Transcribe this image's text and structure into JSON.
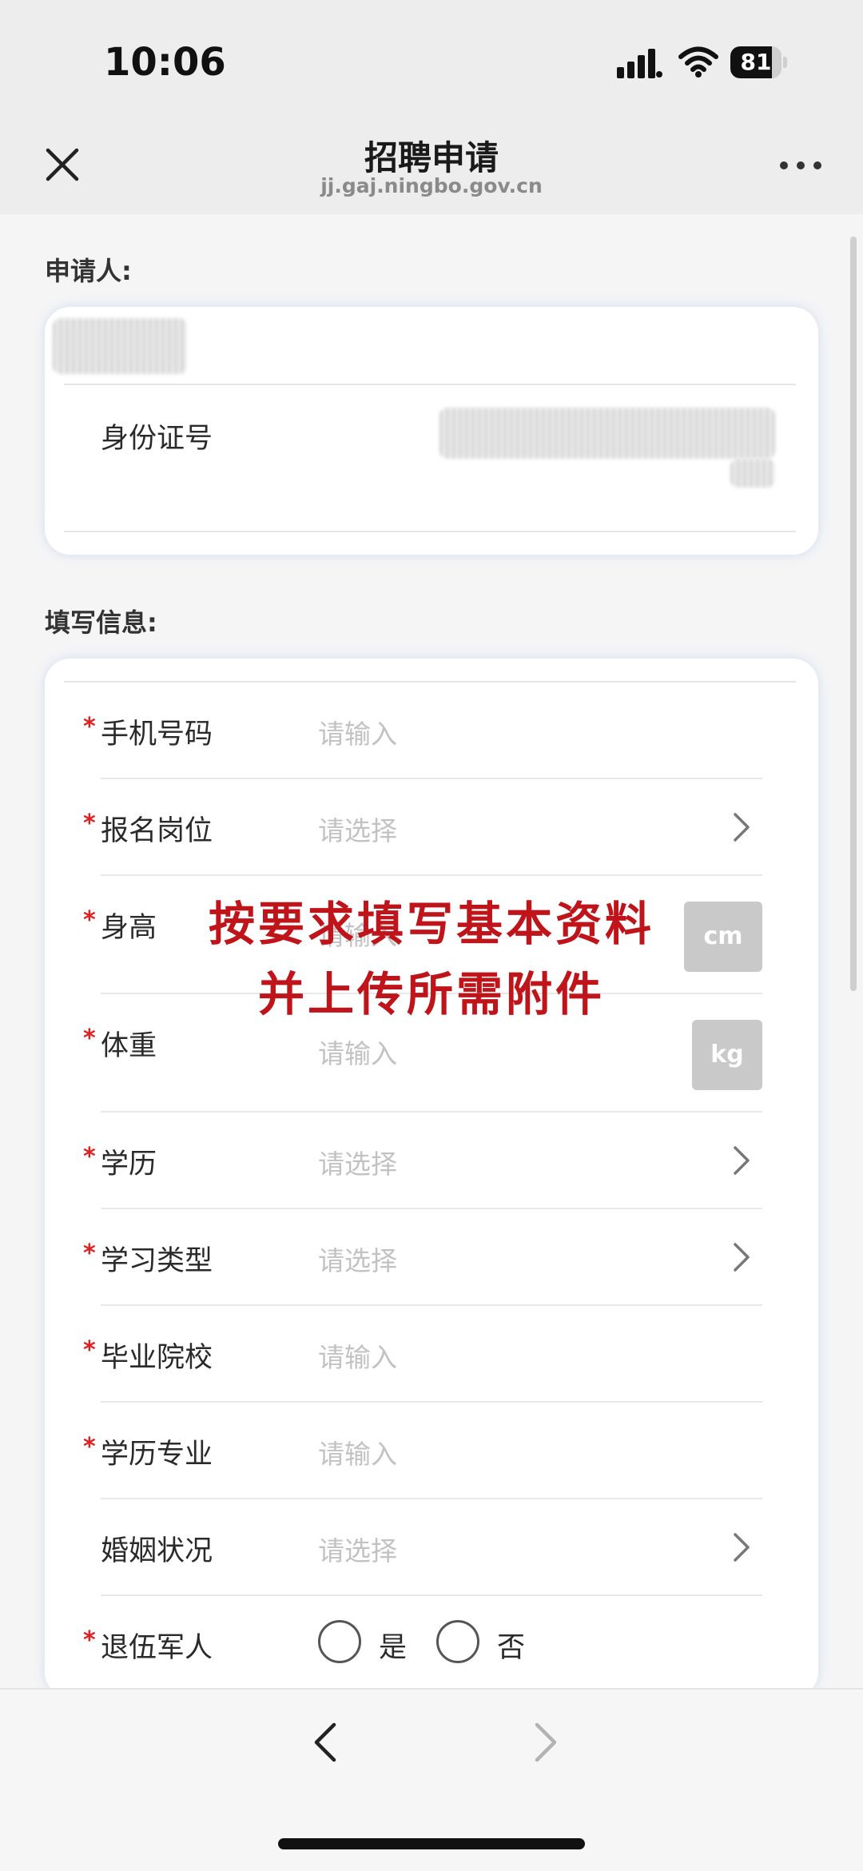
{
  "status_bar": {
    "time": "10:06",
    "battery_level": "81",
    "battery_fill_percent": 81,
    "icons": [
      "signal-icon",
      "wifi-icon",
      "battery-icon"
    ]
  },
  "nav": {
    "title": "招聘申请",
    "subtitle": "jj.gaj.ningbo.gov.cn",
    "icons": [
      "close-icon",
      "more-icon"
    ]
  },
  "applicant": {
    "section_label": "申请人:",
    "id_label": "身份证号"
  },
  "form": {
    "section_label": "填写信息:",
    "rows": [
      {
        "label": "手机号码",
        "value": "请输入",
        "required": true
      },
      {
        "label": "报名岗位",
        "value": "请选择",
        "required": true
      },
      {
        "label": "身高",
        "value": "请输入",
        "required": true,
        "unit": "cm"
      },
      {
        "label": "体重",
        "value": "请输入",
        "required": true,
        "unit": "kg"
      },
      {
        "label": "学历",
        "value": "请选择",
        "required": true
      },
      {
        "label": "学习类型",
        "value": "请选择",
        "required": true
      },
      {
        "label": "毕业院校",
        "value": "请输入",
        "required": true
      },
      {
        "label": "学历专业",
        "value": "请输入",
        "required": true
      },
      {
        "label": "婚姻状况",
        "value": "请选择",
        "required": false
      },
      {
        "label": "退伍军人",
        "required": true,
        "options": [
          "是",
          "否"
        ]
      }
    ],
    "required_mark": "*"
  },
  "overlay": {
    "line1": "按要求填写基本资料",
    "line2": "并上传所需附件"
  },
  "colors": {
    "accent_red": "#e02020",
    "overlay_red": "#c0141b",
    "placeholder": "#c2c2c2"
  },
  "bottom_bar": {
    "icons": [
      "chevron-left-icon",
      "chevron-right-icon"
    ]
  }
}
